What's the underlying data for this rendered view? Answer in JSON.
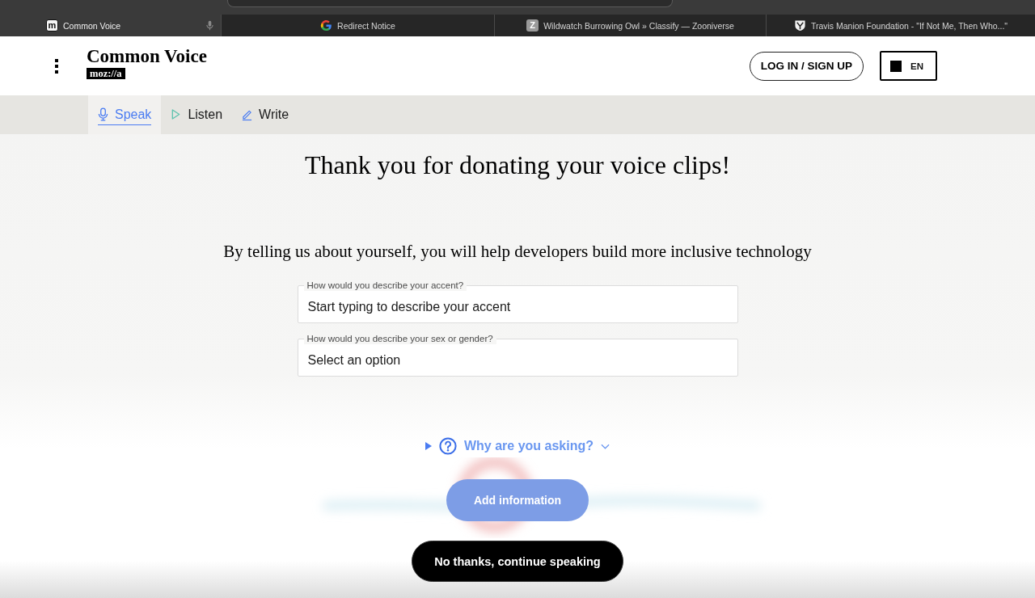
{
  "browser": {
    "tabs": [
      {
        "title": "Common Voice",
        "icon_text": "m",
        "selected": true,
        "mic_in_use": true
      },
      {
        "title": "Redirect Notice",
        "selected": false,
        "mic_in_use": false
      },
      {
        "title": "Wildwatch Burrowing Owl » Classify — Zooniverse",
        "icon_text": "Z",
        "selected": false,
        "mic_in_use": false
      },
      {
        "title": "Travis Manion Foundation - \"If Not Me, Then Who...\"",
        "selected": false,
        "mic_in_use": false
      }
    ]
  },
  "header": {
    "logo": {
      "title": "Common Voice",
      "badge": "moz://a"
    },
    "login_button": "LOG IN / SIGN UP",
    "language_button": "EN"
  },
  "nav": [
    {
      "label": "Speak",
      "selected": true
    },
    {
      "label": "Listen",
      "selected": false
    },
    {
      "label": "Write",
      "selected": false
    }
  ],
  "main": {
    "heading": "Thank you for donating your voice clips!",
    "subheading": "By telling us about yourself, you will help developers build more inclusive technology",
    "fields": [
      {
        "label": "How would you describe your accent?",
        "placeholder": "Start typing to describe your accent"
      },
      {
        "label": "How would you describe your sex or gender?",
        "placeholder": "Select an option"
      }
    ],
    "why_toggle": {
      "label": "Why are you asking?",
      "expanded": false
    },
    "add_button": {
      "label": "Add information",
      "disabled": true
    },
    "skip_button": "No thanks, continue speaking"
  }
}
